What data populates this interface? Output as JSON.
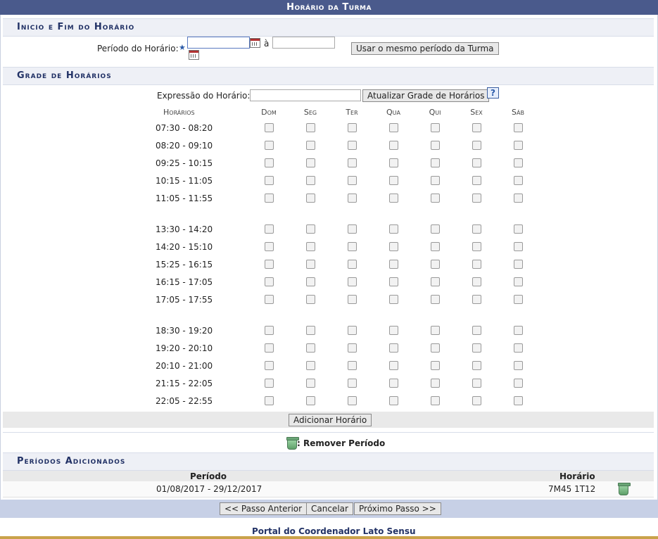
{
  "title": "Horário da Turma",
  "section1": {
    "heading": "Inicio e Fim do Horário",
    "label": "Período do Horário:",
    "required_mark": "★",
    "separator": "à",
    "start_value": "",
    "end_value": "",
    "same_period_button": "Usar o mesmo período da Turma"
  },
  "section2": {
    "heading": "Grade de Horários",
    "expression_label": "Expressão do Horário:",
    "expression_value": "",
    "update_button": "Atualizar Grade de Horários",
    "help": "?",
    "times_header": "Horários",
    "days": [
      "Dom",
      "Seg",
      "Ter",
      "Qua",
      "Qui",
      "Sex",
      "Sáb"
    ],
    "times": [
      "07:30 - 08:20",
      "08:20 - 09:10",
      "09:25 - 10:15",
      "10:15 - 11:05",
      "11:05 - 11:55",
      "13:30 - 14:20",
      "14:20 - 15:10",
      "15:25 - 16:15",
      "16:15 - 17:05",
      "17:05 - 17:55",
      "18:30 - 19:20",
      "19:20 - 20:10",
      "20:10 - 21:00",
      "21:15 - 22:05",
      "22:05 - 22:55"
    ],
    "add_button": "Adicionar Horário"
  },
  "legend": {
    "icon": "trash-icon",
    "text": ": Remover Período"
  },
  "section3": {
    "heading": "Períodos Adicionados",
    "col_period": "Período",
    "col_schedule": "Horário",
    "rows": [
      {
        "period": "01/08/2017 - 29/12/2017",
        "schedule": "7M45 1T12"
      }
    ]
  },
  "nav": {
    "prev": "<< Passo Anterior",
    "cancel": "Cancelar",
    "next": "Próximo Passo >>"
  },
  "footer": "Portal do Coordenador Lato Sensu",
  "colors": {
    "title_bar": "#4a5a8c",
    "section_text": "#223266",
    "footer_strip": "#c7d0e6",
    "bottom_line": "#c9a24a"
  }
}
